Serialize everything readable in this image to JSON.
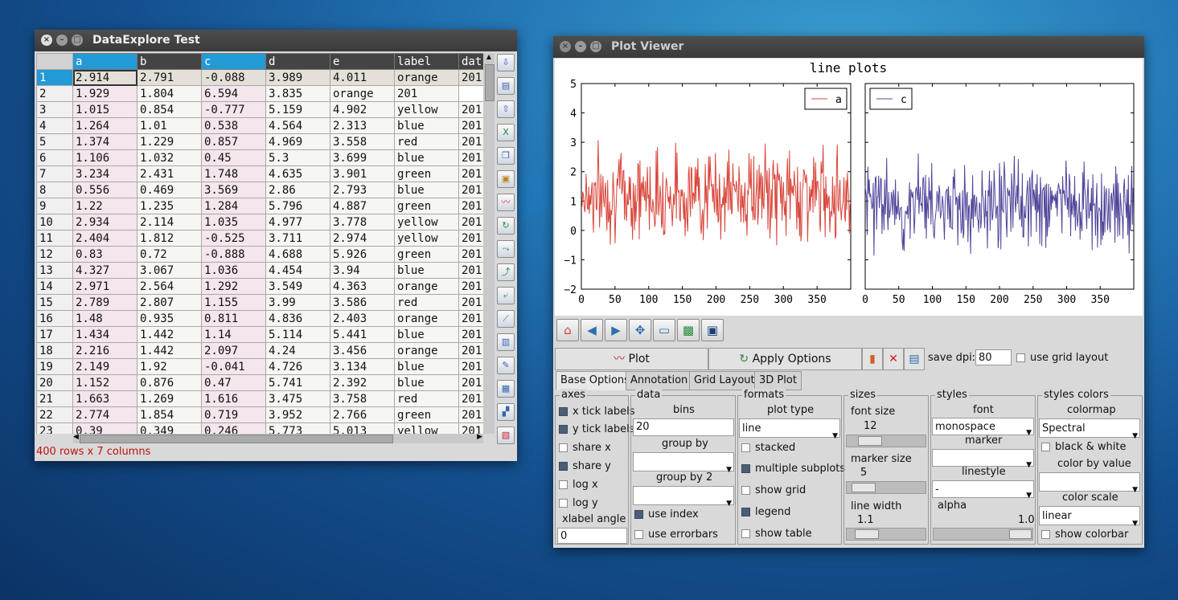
{
  "table_window": {
    "title": "DataExplore Test",
    "columns": [
      "a",
      "b",
      "c",
      "d",
      "e",
      "label",
      "dat"
    ],
    "rows": [
      [
        "1",
        "2.914",
        "2.791",
        "-0.088",
        "3.989",
        "4.011",
        "orange",
        "201"
      ],
      [
        "2",
        "1.929",
        "1.804",
        "6.594",
        "3.835",
        "orange",
        "201"
      ],
      [
        "3",
        "1.015",
        "0.854",
        "-0.777",
        "5.159",
        "4.902",
        "yellow",
        "201"
      ],
      [
        "4",
        "1.264",
        "1.01",
        "0.538",
        "4.564",
        "2.313",
        "blue",
        "201"
      ],
      [
        "5",
        "1.374",
        "1.229",
        "0.857",
        "4.969",
        "3.558",
        "red",
        "201"
      ],
      [
        "6",
        "1.106",
        "1.032",
        "0.45",
        "5.3",
        "3.699",
        "blue",
        "201"
      ],
      [
        "7",
        "3.234",
        "2.431",
        "1.748",
        "4.635",
        "3.901",
        "green",
        "201"
      ],
      [
        "8",
        "0.556",
        "0.469",
        "3.569",
        "2.86",
        "2.793",
        "blue",
        "201"
      ],
      [
        "9",
        "1.22",
        "1.235",
        "1.284",
        "5.796",
        "4.887",
        "green",
        "201"
      ],
      [
        "10",
        "2.934",
        "2.114",
        "1.035",
        "4.977",
        "3.778",
        "yellow",
        "201"
      ],
      [
        "11",
        "2.404",
        "1.812",
        "-0.525",
        "3.711",
        "2.974",
        "yellow",
        "201"
      ],
      [
        "12",
        "0.83",
        "0.72",
        "-0.888",
        "4.688",
        "5.926",
        "green",
        "201"
      ],
      [
        "13",
        "4.327",
        "3.067",
        "1.036",
        "4.454",
        "3.94",
        "blue",
        "201"
      ],
      [
        "14",
        "2.971",
        "2.564",
        "1.292",
        "3.549",
        "4.363",
        "orange",
        "201"
      ],
      [
        "15",
        "2.789",
        "2.807",
        "1.155",
        "3.99",
        "3.586",
        "red",
        "201"
      ],
      [
        "16",
        "1.48",
        "0.935",
        "0.811",
        "4.836",
        "2.403",
        "orange",
        "201"
      ],
      [
        "17",
        "1.434",
        "1.442",
        "1.14",
        "5.114",
        "5.441",
        "blue",
        "201"
      ],
      [
        "18",
        "2.216",
        "1.442",
        "2.097",
        "4.24",
        "3.456",
        "orange",
        "201"
      ],
      [
        "19",
        "2.149",
        "1.92",
        "-0.041",
        "4.726",
        "3.134",
        "blue",
        "201"
      ],
      [
        "20",
        "1.152",
        "0.876",
        "0.47",
        "5.741",
        "2.392",
        "blue",
        "201"
      ],
      [
        "21",
        "1.663",
        "1.269",
        "1.616",
        "3.475",
        "3.758",
        "red",
        "201"
      ],
      [
        "22",
        "2.774",
        "1.854",
        "0.719",
        "3.952",
        "2.766",
        "green",
        "201"
      ],
      [
        "23",
        "0.39",
        "0.349",
        "0.246",
        "5.773",
        "5.013",
        "yellow",
        "201"
      ]
    ],
    "status": "400 rows x 7 columns"
  },
  "plot_window": {
    "title": "Plot Viewer",
    "toolbar": {
      "plot_label": "Plot",
      "apply_label": "Apply Options",
      "save_dpi_label": "save dpi:",
      "save_dpi_value": "80",
      "grid_layout_label": "use grid layout"
    },
    "tabs": [
      "Base Options",
      "Annotation",
      "Grid Layout",
      "3D Plot"
    ],
    "axes": {
      "title": "axes",
      "x_tick": "x tick labels",
      "y_tick": "y tick labels",
      "share_x": "share x",
      "share_y": "share y",
      "log_x": "log x",
      "log_y": "log y",
      "xlabel_angle": "xlabel angle",
      "xlabel_angle_value": "0"
    },
    "data": {
      "title": "data",
      "bins_label": "bins",
      "bins_value": "20",
      "groupby_label": "group by",
      "groupby2_label": "group by 2",
      "use_index": "use index",
      "use_errorbars": "use errorbars"
    },
    "formats": {
      "title": "formats",
      "plot_type_label": "plot type",
      "plot_type_value": "line",
      "stacked": "stacked",
      "multiple_subplots": "multiple subplots",
      "show_grid": "show grid",
      "legend": "legend",
      "show_table": "show table"
    },
    "sizes": {
      "title": "sizes",
      "font_size_label": "font size",
      "font_size_value": "12",
      "marker_size_label": "marker size",
      "marker_size_value": "5",
      "line_width_label": "line width",
      "line_width_value": "1.1"
    },
    "styles": {
      "title": "styles",
      "font_label": "font",
      "font_value": "monospace",
      "marker_label": "marker",
      "linestyle_label": "linestyle",
      "linestyle_value": "-",
      "alpha_label": "alpha",
      "alpha_value": "1.0"
    },
    "styles_colors": {
      "title": "styles colors",
      "colormap_label": "colormap",
      "colormap_value": "Spectral",
      "black_white": "black & white",
      "color_by_value": "color by value",
      "color_scale_label": "color scale",
      "color_scale_value": "linear",
      "show_colorbar": "show colorbar"
    }
  },
  "chart_data": [
    {
      "type": "line",
      "title": "line plots",
      "series": [
        {
          "name": "a",
          "color": "#d9453a",
          "x_range": [
            0,
            399
          ],
          "y_approx_range": [
            -1.4,
            4.6
          ],
          "seed": 7
        }
      ],
      "xlim": [
        0,
        400
      ],
      "ylim": [
        -2,
        5
      ],
      "xticks": [
        0,
        50,
        100,
        150,
        200,
        250,
        300,
        350
      ],
      "yticks": [
        5,
        4,
        3,
        2,
        1,
        0,
        -1,
        -2
      ],
      "ytick_labels": [
        "5",
        "4",
        "3",
        "2",
        "1",
        "0",
        "−1",
        "−2"
      ],
      "legend": "top-right"
    },
    {
      "type": "line",
      "series": [
        {
          "name": "c",
          "color": "#4f479a",
          "x_range": [
            0,
            399
          ],
          "y_approx_range": [
            -1.8,
            4.3
          ],
          "seed": 23
        }
      ],
      "xlim": [
        0,
        400
      ],
      "ylim": [
        -2,
        5
      ],
      "xticks": [
        0,
        50,
        100,
        150,
        200,
        250,
        300,
        350
      ],
      "legend": "top-left"
    }
  ]
}
